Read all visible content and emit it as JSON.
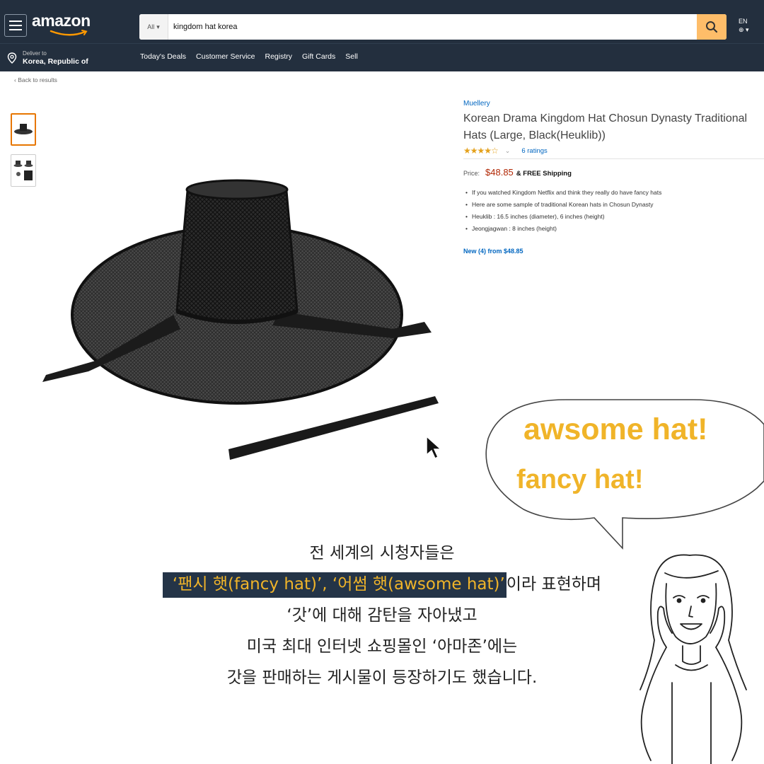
{
  "header": {
    "logo": "amazon",
    "search_category": "All",
    "search_value": "kingdom hat korea",
    "lang": "EN",
    "deliver_label": "Deliver to",
    "deliver_location": "Korea, Republic of",
    "nav": [
      "Today's Deals",
      "Customer Service",
      "Registry",
      "Gift Cards",
      "Sell"
    ]
  },
  "back_link": "‹ Back to results",
  "product": {
    "brand": "Muellery",
    "title": "Korean Drama Kingdom Hat Chosun Dynasty Traditional Hats (Large, Black(Heuklib))",
    "rating_stars": 4.5,
    "stars_text": "★★★★☆",
    "ratings": "6 ratings",
    "price_label": "Price:",
    "price": "$48.85",
    "shipping": "& FREE Shipping",
    "bullets": [
      "If you watched Kingdom Netflix and think they really do have fancy hats",
      "Here are some sample of traditional Korean hats in Chosun Dynasty",
      "Heuklib : 16.5 inches (diameter), 6 inches (height)",
      "Jeongjagwan : 8 inches (height)"
    ],
    "new_offers": "New (4) from $48.85"
  },
  "bubble": {
    "line1": "awsome hat!",
    "line2": "fancy hat!"
  },
  "caption": {
    "line1": "전 세계의 시청자들은",
    "line2_highlight": "‘팬시 햇(fancy hat)’, ‘어썸 햇(awsome hat)’",
    "line2_rest": "이라 표현하며",
    "line3": "‘갓’에 대해 감탄을 자아냈고",
    "line4": "미국 최대 인터넷 쇼핑몰인 ‘아마존’에는",
    "line5": "갓을 판매하는 게시물이 등장하기도 했습니다."
  },
  "colors": {
    "header_bg": "#232f3e",
    "search_button": "#febd69",
    "link": "#0066c0",
    "price": "#b12704",
    "accent_yellow": "#f0b429",
    "highlight_bg": "#243447"
  },
  "icons": [
    "hamburger-menu-icon",
    "search-icon",
    "globe-icon",
    "location-pin-icon",
    "cursor-arrow-icon"
  ]
}
